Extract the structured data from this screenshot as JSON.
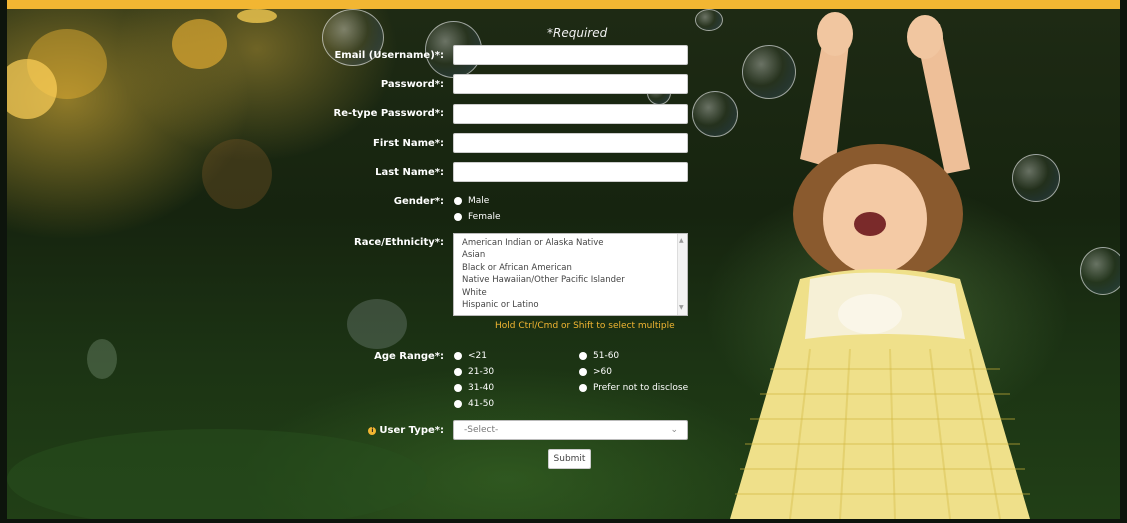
{
  "form": {
    "required_note": "*Required",
    "email_label": "Email (Username)*:",
    "password_label": "Password*:",
    "retype_label": "Re-type Password*:",
    "first_name_label": "First Name*:",
    "last_name_label": "Last Name*:",
    "email_value": "",
    "password_value": "",
    "retype_value": "",
    "first_name_value": "",
    "last_name_value": "",
    "gender_label": "Gender*:",
    "gender_options": [
      "Male",
      "Female"
    ],
    "race_label": "Race/Ethnicity*:",
    "race_options": [
      "American Indian or Alaska Native",
      "Asian",
      "Black or African American",
      "Native Hawaiian/Other Pacific Islander",
      "White",
      "Hispanic or Latino"
    ],
    "race_hint": "Hold Ctrl/Cmd or Shift to select multiple",
    "age_label": "Age Range*:",
    "age_options_left": [
      "<21",
      "21-30",
      "31-40",
      "41-50"
    ],
    "age_options_right": [
      ">60",
      "Prefer not to disclose"
    ],
    "age_option_top_right": "51-60",
    "user_type_label": "User Type*:",
    "user_type_selected": "-Select-",
    "submit_label": "Submit"
  },
  "colors": {
    "accent": "#f2b632",
    "input_bg": "#ffffff"
  },
  "icons": {
    "info": "info-icon",
    "chevron": "chevron-down-icon"
  }
}
